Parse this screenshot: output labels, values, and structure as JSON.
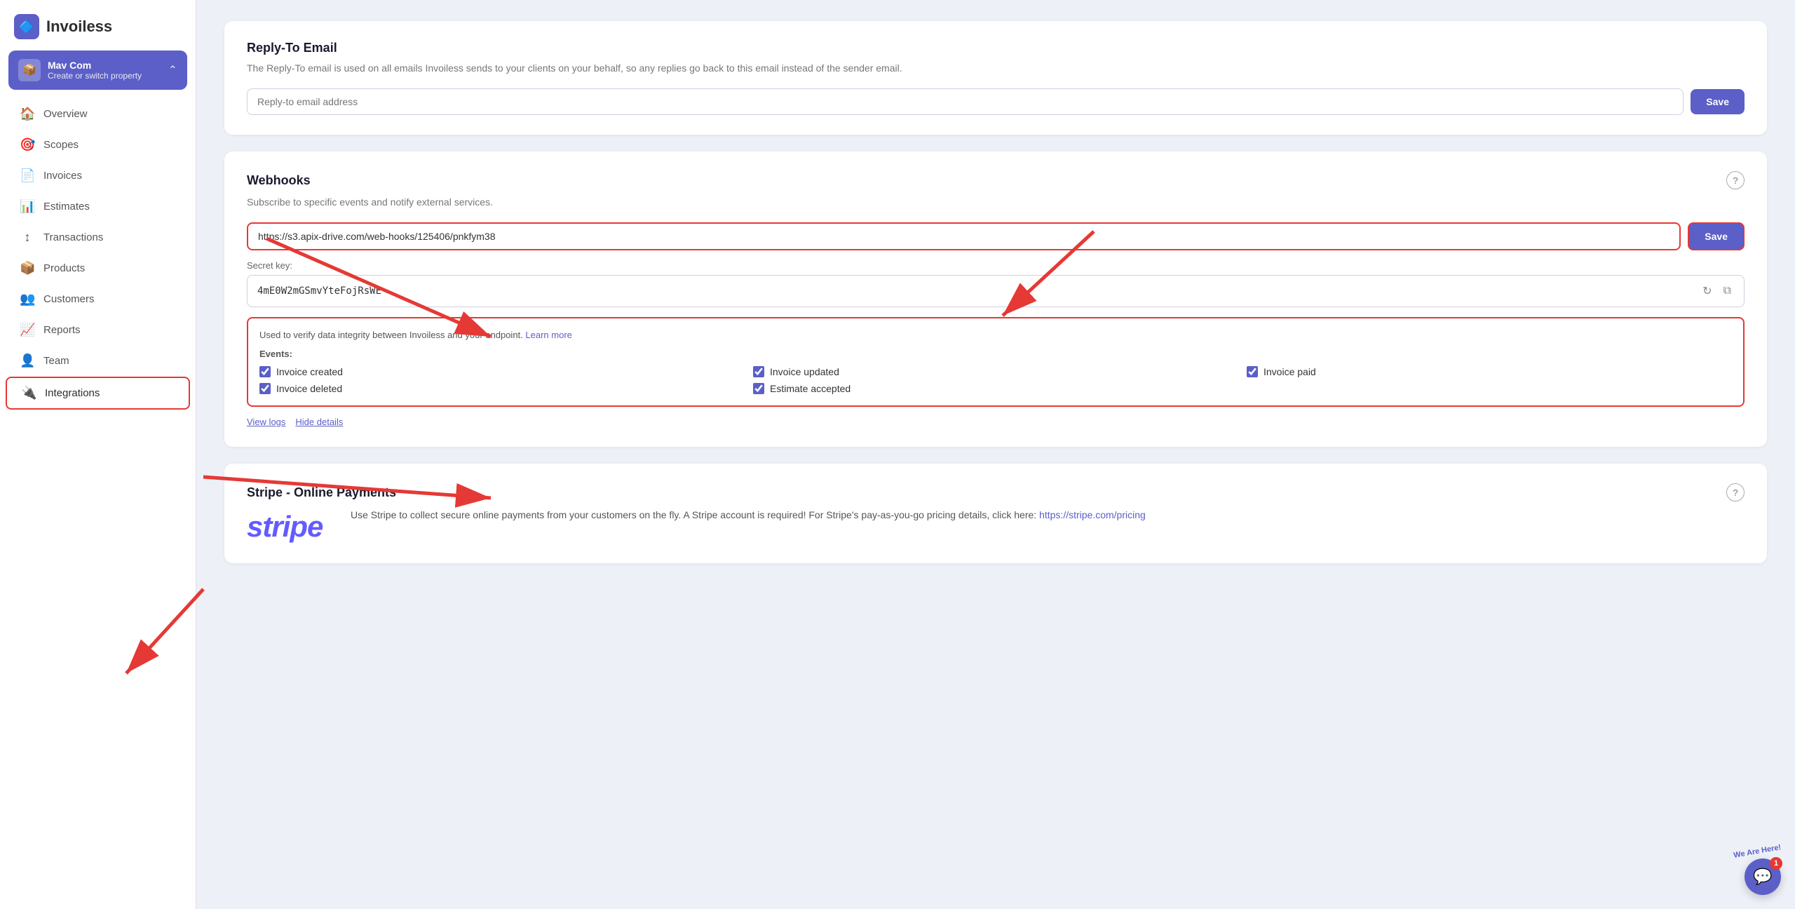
{
  "app": {
    "name": "Invoiless",
    "logo_icon": "🔷"
  },
  "property": {
    "name": "Mav Com",
    "subtitle": "Create or switch property",
    "icon": "📦"
  },
  "nav": {
    "items": [
      {
        "id": "overview",
        "label": "Overview",
        "icon": "🏠"
      },
      {
        "id": "scopes",
        "label": "Scopes",
        "icon": "🎯"
      },
      {
        "id": "invoices",
        "label": "Invoices",
        "icon": "📄"
      },
      {
        "id": "estimates",
        "label": "Estimates",
        "icon": "📊"
      },
      {
        "id": "transactions",
        "label": "Transactions",
        "icon": "↕"
      },
      {
        "id": "products",
        "label": "Products",
        "icon": "📦"
      },
      {
        "id": "customers",
        "label": "Customers",
        "icon": "👥"
      },
      {
        "id": "reports",
        "label": "Reports",
        "icon": "📈"
      },
      {
        "id": "team",
        "label": "Team",
        "icon": "👤"
      },
      {
        "id": "integrations",
        "label": "Integrations",
        "icon": "🔌"
      }
    ]
  },
  "reply_to_email": {
    "section_title": "Reply-To Email",
    "section_desc": "The Reply-To email is used on all emails Invoiless sends to your clients on your behalf, so any replies go back to this email instead of the sender email.",
    "input_placeholder": "Reply-to email address",
    "save_label": "Save"
  },
  "webhooks": {
    "section_title": "Webhooks",
    "section_desc": "Subscribe to specific events and notify external services.",
    "url_value": "https://s3.apix-drive.com/web-hooks/125406/pnkfym38",
    "save_label": "Save",
    "secret_key_label": "Secret key:",
    "secret_key_value": "4mE0W2mGSmvYteFojRsWE",
    "integrity_text": "Used to verify data integrity between Invoiless and your endpoint.",
    "learn_more_label": "Learn more",
    "events_label": "Events:",
    "events": [
      {
        "id": "invoice_created",
        "label": "Invoice created",
        "checked": true
      },
      {
        "id": "invoice_updated",
        "label": "Invoice updated",
        "checked": true
      },
      {
        "id": "invoice_paid",
        "label": "Invoice paid",
        "checked": true
      },
      {
        "id": "invoice_deleted",
        "label": "Invoice deleted",
        "checked": true
      },
      {
        "id": "estimate_accepted",
        "label": "Estimate accepted",
        "checked": true
      }
    ],
    "view_logs_label": "View logs",
    "hide_details_label": "Hide details"
  },
  "stripe": {
    "section_title": "Stripe - Online Payments",
    "logo_text": "stripe",
    "desc": "Use Stripe to collect secure online payments from your customers on the fly. A Stripe account is required! For Stripe's pay-as-you-go pricing details, click here:",
    "link_url": "https://stripe.com/pricing",
    "link_label": "https://stripe.com/pricing"
  },
  "chat": {
    "badge_count": "1",
    "badge_text": "We Are Here!"
  }
}
